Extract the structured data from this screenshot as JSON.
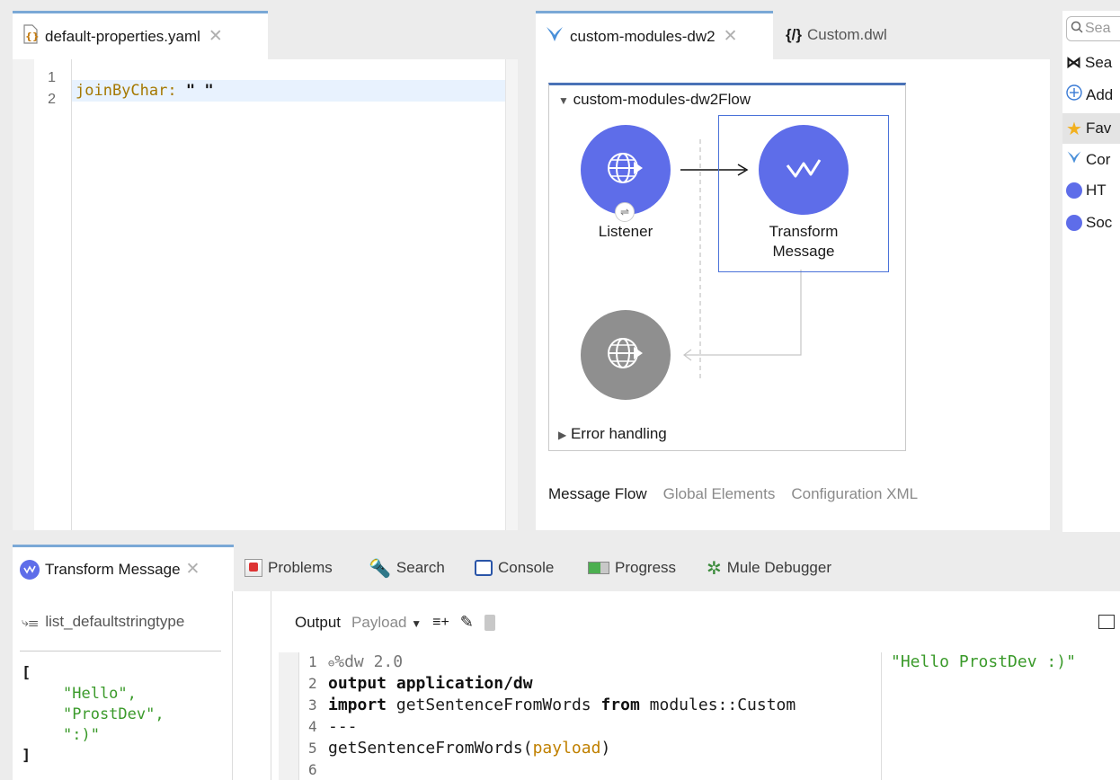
{
  "yaml_editor": {
    "tab_label": "default-properties.yaml",
    "line_numbers": [
      "1",
      "2"
    ],
    "line2_key": "joinByChar:",
    "line2_value": "\" \""
  },
  "flow_editor": {
    "tabs": [
      {
        "label": "custom-modules-dw2"
      },
      {
        "label": "Custom.dwl"
      }
    ],
    "flow_name": "custom-modules-dw2Flow",
    "listener_label": "Listener",
    "transform_label_1": "Transform",
    "transform_label_2": "Message",
    "error_handling_label": "Error handling",
    "bottom_tabs": [
      "Message Flow",
      "Global Elements",
      "Configuration XML"
    ]
  },
  "palette": {
    "search_placeholder": "Sea",
    "items": [
      "Sea",
      "Add",
      "Fav",
      "Cor",
      "HT",
      "Soc"
    ]
  },
  "bottom_panel": {
    "tabs": [
      "Transform Message",
      "Problems",
      "Search",
      "Console",
      "Progress",
      "Mule Debugger"
    ],
    "input_type": "list_defaultstringtype",
    "input_lines": [
      "[",
      "\"Hello\",",
      "\"ProstDev\",",
      "\":)\"",
      "]"
    ],
    "output_label": "Output",
    "payload_label": "Payload",
    "code": {
      "line1": "%dw 2.0",
      "line2_kw": "output",
      "line2_rest": "application/dw",
      "line3_kw": "import",
      "line3_mid": "getSentenceFromWords",
      "line3_kw2": "from",
      "line3_rest": "modules::Custom",
      "line4": "---",
      "line5_fn": "getSentenceFromWords(",
      "line5_arg": "payload",
      "line5_end": ")",
      "line_numbers": [
        "1",
        "2",
        "3",
        "4",
        "5",
        "6"
      ]
    },
    "preview_value": "\"Hello ProstDev :)\""
  },
  "colors": {
    "accent": "#5e6de9",
    "tab_border": "#7aa8d6",
    "string_green": "#3a9a2a"
  }
}
